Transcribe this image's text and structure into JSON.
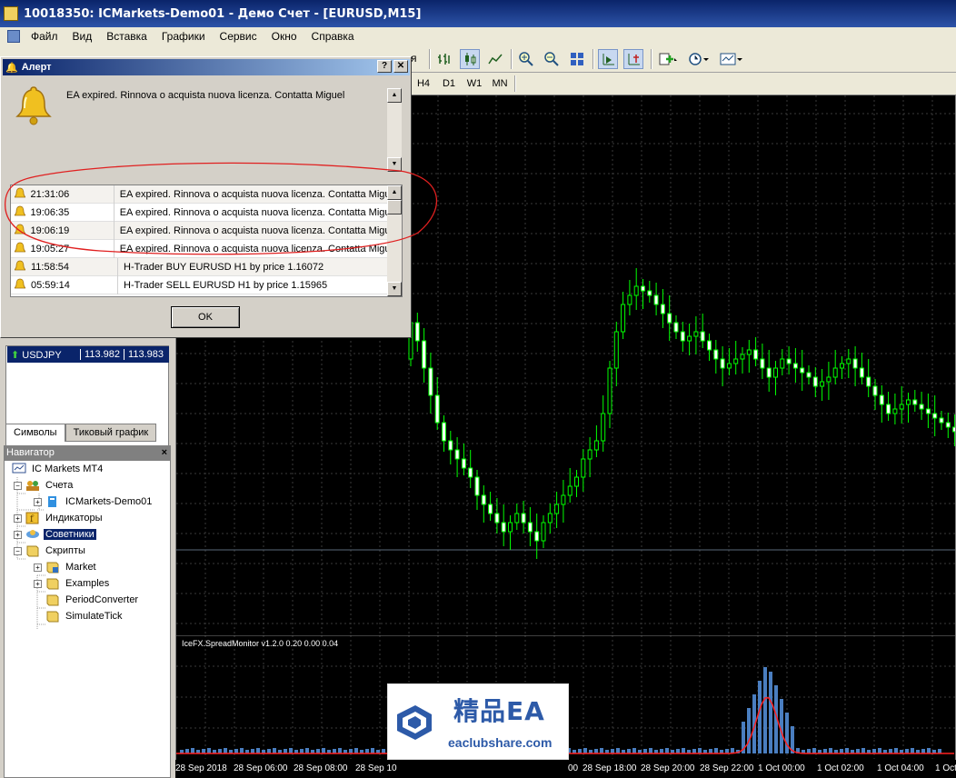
{
  "window": {
    "title": "10018350: ICMarkets-Demo01 - Демо Счет - [EURUSD,M15]"
  },
  "menu": [
    "Файл",
    "Вид",
    "Вставка",
    "Графики",
    "Сервис",
    "Окно",
    "Справка"
  ],
  "timeframes": [
    "H4",
    "D1",
    "W1",
    "MN"
  ],
  "toolbar_stub": "я",
  "alert": {
    "title": "Алерт",
    "help_label": "?",
    "close_label": "✕",
    "message": "EA expired. Rinnova o acquista nuova licenza. Contatta Miguel",
    "ok_label": "OK",
    "rows": [
      {
        "time": "21:31:06",
        "msg": "EA expired. Rinnova o acquista nuova licenza. Contatta Miguel"
      },
      {
        "time": "19:06:35",
        "msg": "EA expired. Rinnova o acquista nuova licenza. Contatta Miguel"
      },
      {
        "time": "19:06:19",
        "msg": "EA expired. Rinnova o acquista nuova licenza. Contatta Miguel"
      },
      {
        "time": "19:05:27",
        "msg": "EA expired. Rinnova o acquista nuova licenza. Contatta Miguel"
      },
      {
        "time": "11:58:54",
        "msg": "H-Trader BUY EURUSD H1 by price 1.16072"
      },
      {
        "time": "05:59:14",
        "msg": "H-Trader SELL EURUSD H1 by price 1.15965"
      }
    ]
  },
  "market_watch": {
    "row": {
      "symbol": "USDJPY",
      "bid": "113.982",
      "ask": "113.983"
    },
    "tabs": [
      "Символы",
      "Тиковый график"
    ]
  },
  "navigator": {
    "title": "Навигатор",
    "close": "×",
    "items": [
      "IC Markets MT4",
      "Счета",
      "ICMarkets-Demo01",
      "Индикаторы",
      "Советники",
      "Скрипты",
      "Market",
      "Examples",
      "PeriodConverter",
      "SimulateTick"
    ]
  },
  "indicator": {
    "label": "IceFX.SpreadMonitor v1.2.0  0.20  0.00  0.04"
  },
  "time_axis": [
    "28 Sep 2018",
    "28 Sep 06:00",
    "28 Sep 08:00",
    "28 Sep 10",
    "00",
    "28 Sep 18:00",
    "28 Sep 20:00",
    "28 Sep 22:00",
    "1 Oct 00:00",
    "1 Oct 02:00",
    "1 Oct 04:00",
    "1 Oct"
  ],
  "watermark": {
    "brand": "精品EA",
    "url": "eaclubshare.com"
  },
  "colors": {
    "candle": "#00ff00",
    "bar": "#4a7ec0",
    "spread_line": "#ff2020",
    "annotation": "#e02020",
    "selection": "#0a246a"
  },
  "icons": [
    "bell-icon",
    "zoom-in-icon",
    "zoom-out-icon",
    "bar-chart-icon",
    "candle-chart-icon",
    "line-chart-icon",
    "clock-icon"
  ]
}
